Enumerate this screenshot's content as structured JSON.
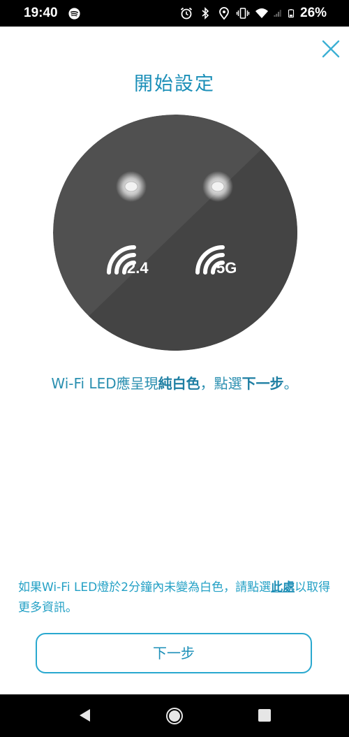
{
  "status_bar": {
    "time": "19:40",
    "battery_percent": "26%",
    "icons": [
      "spotify-icon",
      "alarm-icon",
      "bluetooth-icon",
      "location-icon",
      "vibrate-icon",
      "wifi-icon",
      "signal-icon",
      "battery-icon"
    ]
  },
  "header": {
    "title": "開始設定",
    "close_icon": "close-icon"
  },
  "illustration": {
    "band_24_label": "2.4",
    "band_5_label": "5G",
    "led_color": "#ffffff",
    "device_color": "#4a4a4a"
  },
  "instruction": {
    "prefix": "Wi-Fi LED應呈現",
    "highlight": "純白色",
    "suffix": "，點選",
    "action": "下一步",
    "end": "。"
  },
  "help": {
    "text_before": "如果Wi-Fi LED燈於2分鐘內未變為白色，請點選",
    "link": "此處",
    "text_after": "以取得更多資訊。"
  },
  "next_button": {
    "label": "下一步"
  },
  "nav_bar": {
    "icons": [
      "back-icon",
      "home-icon",
      "recents-icon"
    ]
  },
  "colors": {
    "accent": "#1b8fb8",
    "button_border": "#29a8cf"
  }
}
